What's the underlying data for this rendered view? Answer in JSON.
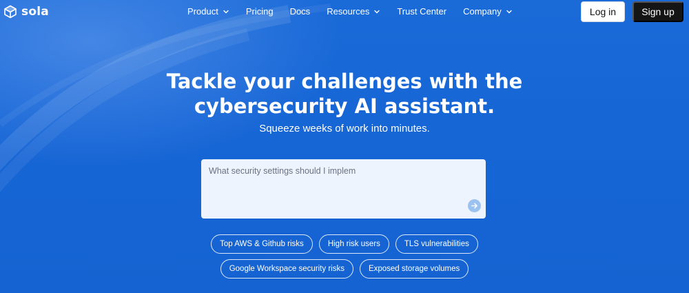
{
  "brand": {
    "name": "sola",
    "logo_icon": "cube-logo-icon"
  },
  "nav": {
    "items": [
      {
        "label": "Product",
        "has_dropdown": true
      },
      {
        "label": "Pricing",
        "has_dropdown": false
      },
      {
        "label": "Docs",
        "has_dropdown": false
      },
      {
        "label": "Resources",
        "has_dropdown": true
      },
      {
        "label": "Trust Center",
        "has_dropdown": false
      },
      {
        "label": "Company",
        "has_dropdown": true
      }
    ],
    "login_label": "Log in",
    "signup_label": "Sign up"
  },
  "hero": {
    "title_line1": "Tackle your challenges with the",
    "title_line2": "cybersecurity AI assistant.",
    "subtitle": "Squeeze weeks of work into minutes."
  },
  "prompt": {
    "placeholder": "What security settings should I implem",
    "value": "",
    "send_icon": "arrow-right-icon"
  },
  "suggestions": {
    "row1": [
      "Top AWS & Github risks",
      "High risk users",
      "TLS vulnerabilities"
    ],
    "row2": [
      "Google Workspace security risks",
      "Exposed storage volumes"
    ]
  },
  "colors": {
    "background": "#1766d6",
    "signup_bg": "#151515",
    "login_bg": "#ffffff",
    "prompt_bg": "#eef4fd",
    "send_button": "#9cc3f0"
  }
}
